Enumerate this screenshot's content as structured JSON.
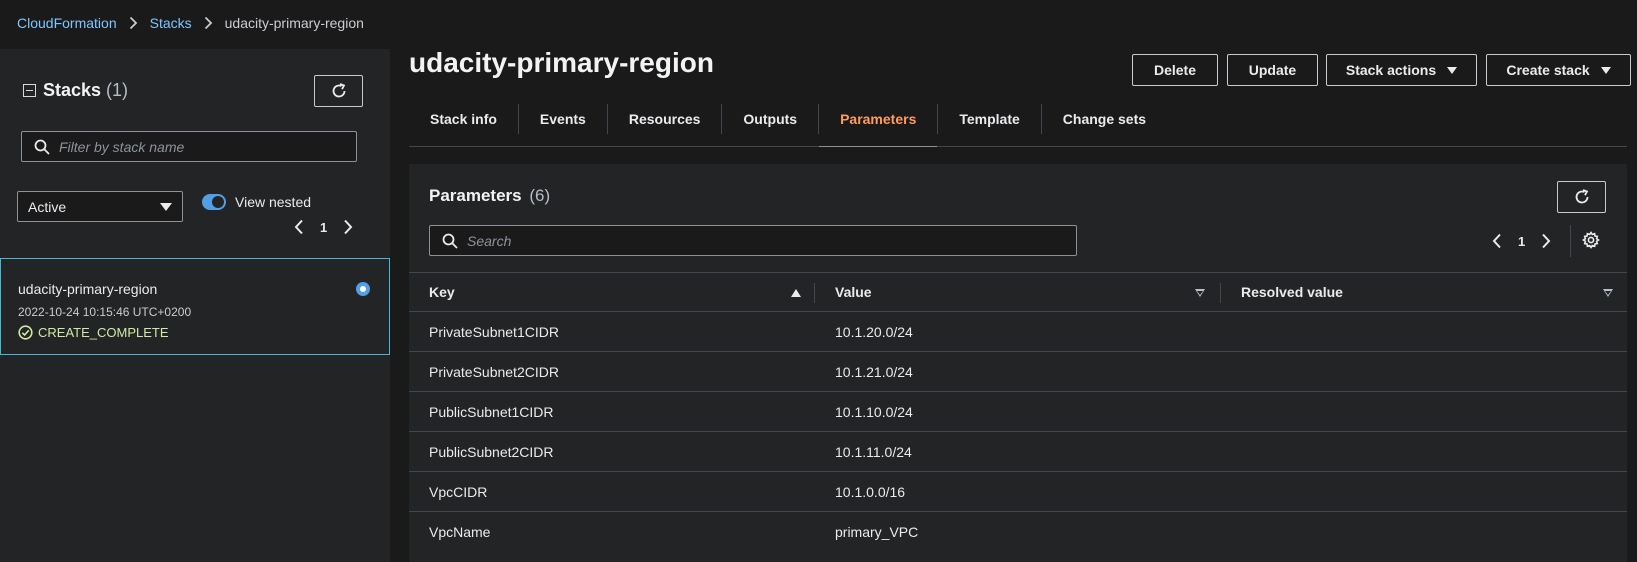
{
  "breadcrumb": {
    "items": [
      "CloudFormation",
      "Stacks",
      "udacity-primary-region"
    ]
  },
  "left": {
    "title": "Stacks",
    "count": "(1)",
    "filter_placeholder": "Filter by stack name",
    "status_filter": "Active",
    "view_nested_label": "View nested",
    "page": "1",
    "stack": {
      "name": "udacity-primary-region",
      "timestamp": "2022-10-24 10:15:46 UTC+0200",
      "status": "CREATE_COMPLETE"
    }
  },
  "header": {
    "title": "udacity-primary-region",
    "buttons": {
      "delete": "Delete",
      "update": "Update",
      "stack_actions": "Stack actions",
      "create_stack": "Create stack"
    }
  },
  "tabs": [
    "Stack info",
    "Events",
    "Resources",
    "Outputs",
    "Parameters",
    "Template",
    "Change sets"
  ],
  "parameters": {
    "title": "Parameters",
    "count": "(6)",
    "search_placeholder": "Search",
    "page": "1",
    "columns": [
      "Key",
      "Value",
      "Resolved value"
    ],
    "rows": [
      {
        "key": "PrivateSubnet1CIDR",
        "value": "10.1.20.0/24",
        "resolved": ""
      },
      {
        "key": "PrivateSubnet2CIDR",
        "value": "10.1.21.0/24",
        "resolved": ""
      },
      {
        "key": "PublicSubnet1CIDR",
        "value": "10.1.10.0/24",
        "resolved": ""
      },
      {
        "key": "PublicSubnet2CIDR",
        "value": "10.1.11.0/24",
        "resolved": ""
      },
      {
        "key": "VpcCIDR",
        "value": "10.1.0.0/16",
        "resolved": ""
      },
      {
        "key": "VpcName",
        "value": "primary_VPC",
        "resolved": ""
      }
    ]
  },
  "colors": {
    "link": "#7fc6ff",
    "active_tab": "#ff9b5d",
    "success": "#d3e8a6",
    "selection_border": "#44b9d6",
    "toggle_on": "#539fe5"
  }
}
